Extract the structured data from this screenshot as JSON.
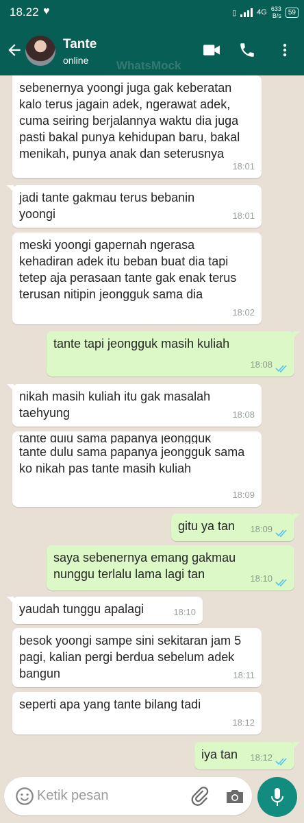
{
  "status_bar": {
    "time": "18.22",
    "network": "4G",
    "speed_value": "633",
    "speed_unit": "B/s",
    "battery": "59"
  },
  "header": {
    "contact_name": "Tante",
    "contact_status": "online",
    "watermark": "WhatsMock"
  },
  "messages": [
    {
      "direction": "in",
      "text": "sebenernya yoongi juga gak keberatan kalo terus jagain adek, ngerawat adek, cuma seiring berjalannya waktu dia juga pasti bakal punya kehidupan baru, bakal menikah, punya anak dan seterusnya",
      "time": "18:01"
    },
    {
      "direction": "in",
      "text": "jadi tante gakmau terus bebanin yoongi",
      "time": "18:01"
    },
    {
      "direction": "in",
      "text": "meski yoongi gapernah ngerasa kehadiran adek itu beban buat dia tapi tetep aja perasaan tante gak enak terus terusan nitipin jeongguk sama dia",
      "time": "18:02"
    },
    {
      "direction": "out",
      "text": "tante tapi jeongguk masih kuliah",
      "time": "18:08",
      "read": true
    },
    {
      "direction": "in",
      "text": "nikah masih kuliah itu gak masalah taehyung",
      "time": "18:08"
    },
    {
      "direction": "in",
      "text": "tante dulu sama papanya jeongguk",
      "text2": "tante dulu sama papanya jeongguk sama ko nikah pas tante masih kuliah",
      "time": "18:09"
    },
    {
      "direction": "out",
      "text": "gitu ya tan",
      "time": "18:09",
      "read": true
    },
    {
      "direction": "out",
      "text": "saya sebenernya emang gakmau nunggu terlalu lama lagi tan",
      "time": "18:10",
      "read": true
    },
    {
      "direction": "in",
      "text": "yaudah tunggu apalagi",
      "time": "18:10"
    },
    {
      "direction": "in",
      "text": "besok yoongi sampe sini sekitaran jam 5 pagi, kalian pergi berdua sebelum adek bangun",
      "time": "18:11"
    },
    {
      "direction": "in",
      "text": "seperti apa yang tante bilang tadi",
      "time": "18:12"
    },
    {
      "direction": "out",
      "text": "iya tan",
      "time": "18:12",
      "read": true
    }
  ],
  "input": {
    "placeholder": "Ketik pesan"
  },
  "colors": {
    "header": "#075e54",
    "outgoing_bubble": "#dcf8c6",
    "incoming_bubble": "#ffffff",
    "read_tick": "#4fc3f7",
    "mic_button": "#128c7e"
  },
  "icons": [
    "back-arrow-icon",
    "video-call-icon",
    "phone-icon",
    "more-vert-icon",
    "emoji-icon",
    "attach-icon",
    "camera-icon",
    "mic-icon",
    "double-check-icon"
  ]
}
